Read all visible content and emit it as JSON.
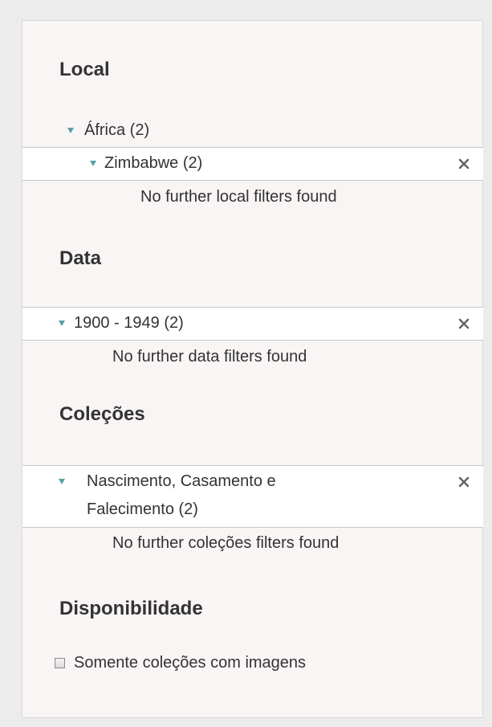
{
  "filters": {
    "local": {
      "heading": "Local",
      "parent_label": "África (2)",
      "selected_label": "Zimbabwe (2)",
      "no_more": "No further local filters found"
    },
    "data": {
      "heading": "Data",
      "selected_label": "1900 - 1949 (2)",
      "no_more": "No further data filters found"
    },
    "colecoes": {
      "heading": "Coleções",
      "selected_label_line1": "Nascimento, Casamento e",
      "selected_label_line2": "Falecimento (2)",
      "no_more": "No further coleções filters found"
    },
    "disponibilidade": {
      "heading": "Disponibilidade",
      "checkbox_label": "Somente coleções com imagens",
      "checked": false
    }
  },
  "icons": {
    "expand": "caret-down-icon",
    "remove": "close-icon"
  },
  "colors": {
    "accent": "#5a9ea5",
    "panel_background": "#f8f5f4",
    "row_background": "#ffffff",
    "text": "#333333"
  }
}
